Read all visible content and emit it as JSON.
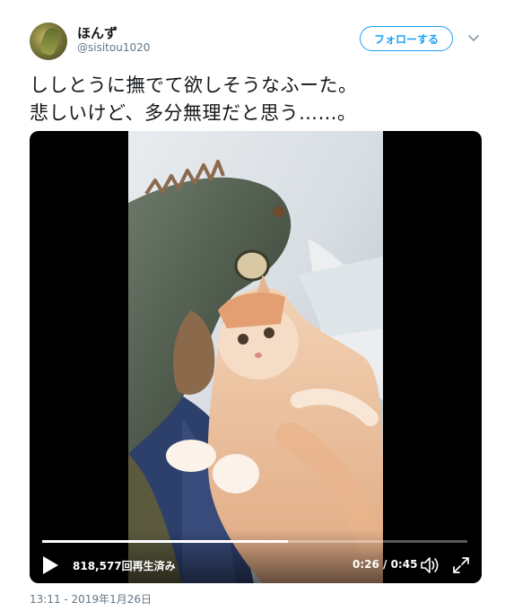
{
  "header": {
    "display_name": "ほんず",
    "handle": "@sisitou1020",
    "follow_label": "フォローする",
    "avatar_icon": "iguana-avatar",
    "more_icon": "chevron-down-icon"
  },
  "tweet": {
    "text": "ししとうに撫でて欲しそうなふーた。\n悲しいけど、多分無理だと思う……。"
  },
  "video": {
    "views": "818,577回再生済み",
    "time": "0:26 / 0:45",
    "progress": 0.578,
    "play_icon": "play-icon",
    "volume_icon": "volume-icon",
    "fullscreen_icon": "fullscreen-icon"
  },
  "footer": {
    "timestamp": "13:11 - 2019年1月26日"
  },
  "colors": {
    "accent": "#1da1f2",
    "text": "#14171a",
    "secondary": "#657786"
  }
}
